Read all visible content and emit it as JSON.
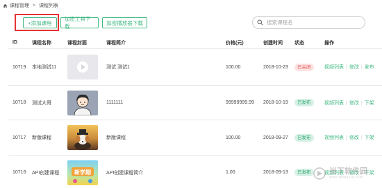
{
  "breadcrumb": {
    "root": "课程管理",
    "sep": ">",
    "current": "课程列表"
  },
  "toolbar": {
    "add_label": "+添加课程",
    "tool_download_label": "加密工具下载",
    "player_download_label": "加密播放器下载"
  },
  "search": {
    "placeholder": "搜索课程名"
  },
  "table": {
    "headers": {
      "id": "ID",
      "name": "课程名称",
      "cover": "课程封面",
      "intro": "课程简介",
      "price": "价格(元)",
      "time": "创建时间",
      "status": "状态",
      "ops": "操作"
    },
    "rows": [
      {
        "id": "10719",
        "name": "本地测试11",
        "cover": "play",
        "intro": "测试 测试1",
        "price": "100.00",
        "time": "2018-10-23",
        "status": "已关闭",
        "ops": [
          "视频列表",
          "修改",
          "发布"
        ]
      },
      {
        "id": "10718",
        "name": "测试大哥",
        "cover": "avatar",
        "intro": "1111111",
        "price": "99999999.99",
        "time": "2018-10-19",
        "status": "已发布",
        "ops": [
          "视频列表",
          "修改",
          "下架"
        ]
      },
      {
        "id": "10717",
        "name": "新版课程",
        "cover": "dog",
        "intro": "新版课程",
        "price": "100.00",
        "time": "2018-09-27",
        "status": "已发布",
        "ops": [
          "视频列表",
          "修改",
          "下架"
        ]
      },
      {
        "id": "10716",
        "name": "API创建课程",
        "cover": "school",
        "cover_text": "新学期",
        "intro": "API创建课程简介",
        "price": "1.00",
        "time": "2018-09-13",
        "status": "已发布",
        "ops": [
          "视频列表",
          "修改",
          "下架"
        ]
      }
    ]
  },
  "watermark": {
    "text": "当下软件园",
    "sub": "www.downxia.com"
  },
  "colors": {
    "accent": "#42b983",
    "danger": "#e63232",
    "closed_bg": "#fde2e2",
    "published_bg": "#d7f1e6"
  }
}
